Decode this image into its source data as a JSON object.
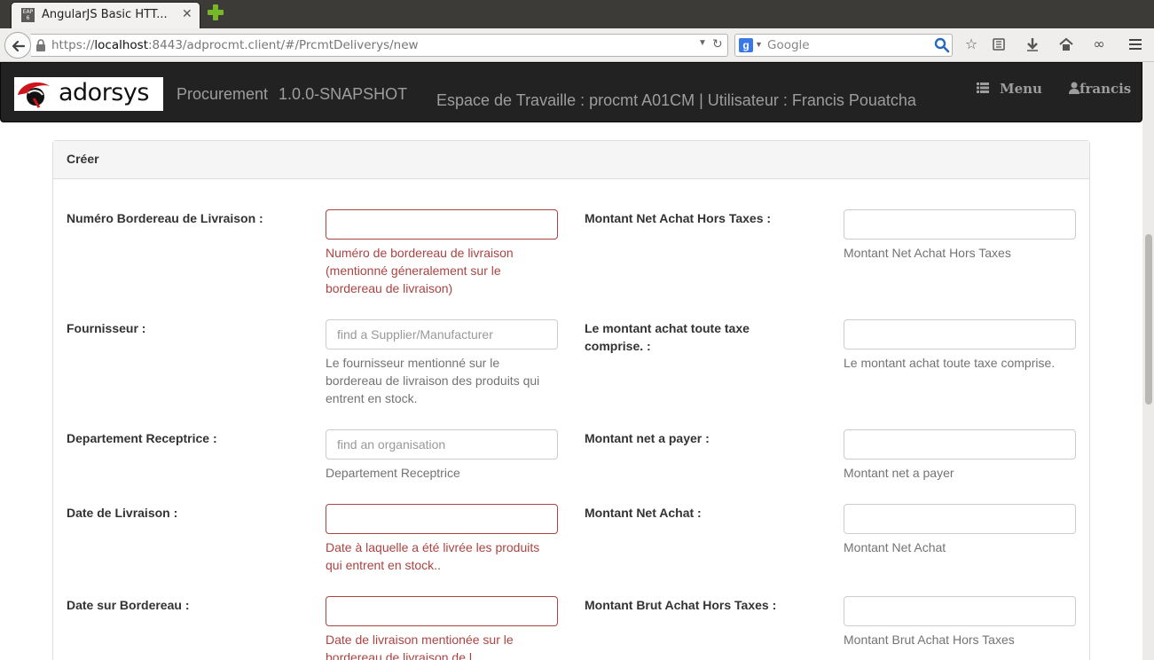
{
  "browser": {
    "tab_title": "AngularJS Basic HTT...",
    "tab_favicon_text": "EAP 6",
    "url_scheme": "https://",
    "url_host": "localhost",
    "url_rest": ":8443/adprocmt.client/#/PrcmtDeliverys/new",
    "search_placeholder": "Google"
  },
  "app": {
    "logo_text": "adorsys",
    "brand_name": "Procurement",
    "version": "1.0.0-SNAPSHOT",
    "workspace": "Espace de Travaille : procmt A01CM | Utilisateur : Francis Pouatcha",
    "menu_label": "Menu",
    "user_label": "francis"
  },
  "panel": {
    "title": "Créer"
  },
  "form": {
    "left": [
      {
        "label": "Numéro Bordereau de Livraison :",
        "value": "",
        "placeholder": "",
        "help": "Numéro de bordereau de livraison (mentionné géneralement sur le bordereau de livraison)"
      },
      {
        "label": "Fournisseur :",
        "value": "",
        "placeholder": "find a Supplier/Manufacturer",
        "help": "Le fournisseur mentionné sur le bordereau de livraison des produits qui entrent en stock."
      },
      {
        "label": "Departement Receptrice :",
        "value": "",
        "placeholder": "find an organisation",
        "help": "Departement Receptrice"
      },
      {
        "label": "Date de Livraison :",
        "value": "",
        "placeholder": "",
        "help": "Date à laquelle a été livrée les produits qui entrent en stock.."
      },
      {
        "label": "Date sur Bordereau :",
        "value": "",
        "placeholder": "",
        "help": "Date de livraison mentionée sur le bordereau de livraison de l"
      }
    ],
    "right": [
      {
        "label": "Montant Net Achat Hors Taxes :",
        "value": "",
        "help": "Montant Net Achat Hors Taxes"
      },
      {
        "label": "Le montant achat toute taxe comprise. :",
        "value": "",
        "help": "Le montant achat toute taxe comprise."
      },
      {
        "label": "Montant net a payer :",
        "value": "",
        "help": "Montant net a payer"
      },
      {
        "label": "Montant Net Achat :",
        "value": "",
        "help": "Montant Net Achat"
      },
      {
        "label": "Montant Brut Achat Hors Taxes :",
        "value": "",
        "help": "Montant Brut Achat Hors Taxes"
      }
    ]
  },
  "colors": {
    "navbar_bg": "#222222",
    "error": "#a94442",
    "help": "#737373",
    "logo_red": "#d0121b"
  }
}
